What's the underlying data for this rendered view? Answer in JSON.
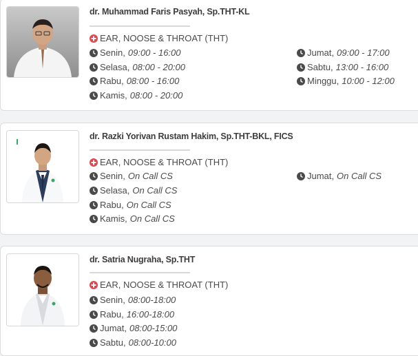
{
  "colors": {
    "plus_icon": "#e0464f",
    "clock_icon": "#4a4a4a"
  },
  "doctors": [
    {
      "name": "dr. Muhammad Faris Pasyah, Sp.THT-KL",
      "specialty": "EAR, NOOSE & THROAT (THT)",
      "schedule_left": [
        {
          "day": "Senin,",
          "time": "09:00 - 16:00"
        },
        {
          "day": "Selasa,",
          "time": "08:00 - 20:00"
        },
        {
          "day": "Rabu,",
          "time": "08:00 - 16:00"
        },
        {
          "day": "Kamis,",
          "time": "08:00 - 20:00"
        }
      ],
      "schedule_right": [
        {
          "day": "Jumat,",
          "time": "09:00 - 17:00"
        },
        {
          "day": "Sabtu,",
          "time": "13:00 - 16:00"
        },
        {
          "day": "Minggu,",
          "time": "10:00 - 12:00"
        }
      ]
    },
    {
      "name": "dr. Razki Yorivan Rustam Hakim, Sp.THT-BKL, FICS",
      "specialty": "EAR, NOOSE & THROAT (THT)",
      "schedule_left": [
        {
          "day": "Senin,",
          "time": "On Call CS"
        },
        {
          "day": "Selasa,",
          "time": "On Call CS"
        },
        {
          "day": "Rabu,",
          "time": "On Call CS"
        },
        {
          "day": "Kamis,",
          "time": "On Call CS"
        }
      ],
      "schedule_right": [
        {
          "day": "Jumat,",
          "time": "On Call CS"
        }
      ]
    },
    {
      "name": "dr. Satria Nugraha, Sp.THT",
      "specialty": "EAR, NOOSE & THROAT (THT)",
      "schedule_left": [
        {
          "day": "Senin,",
          "time": "08:00-18:00"
        },
        {
          "day": "Rabu,",
          "time": "16:00-18:00"
        },
        {
          "day": "Jumat,",
          "time": "08:00-15:00"
        },
        {
          "day": "Sabtu,",
          "time": "08:00-10:00"
        }
      ],
      "schedule_right": []
    }
  ]
}
